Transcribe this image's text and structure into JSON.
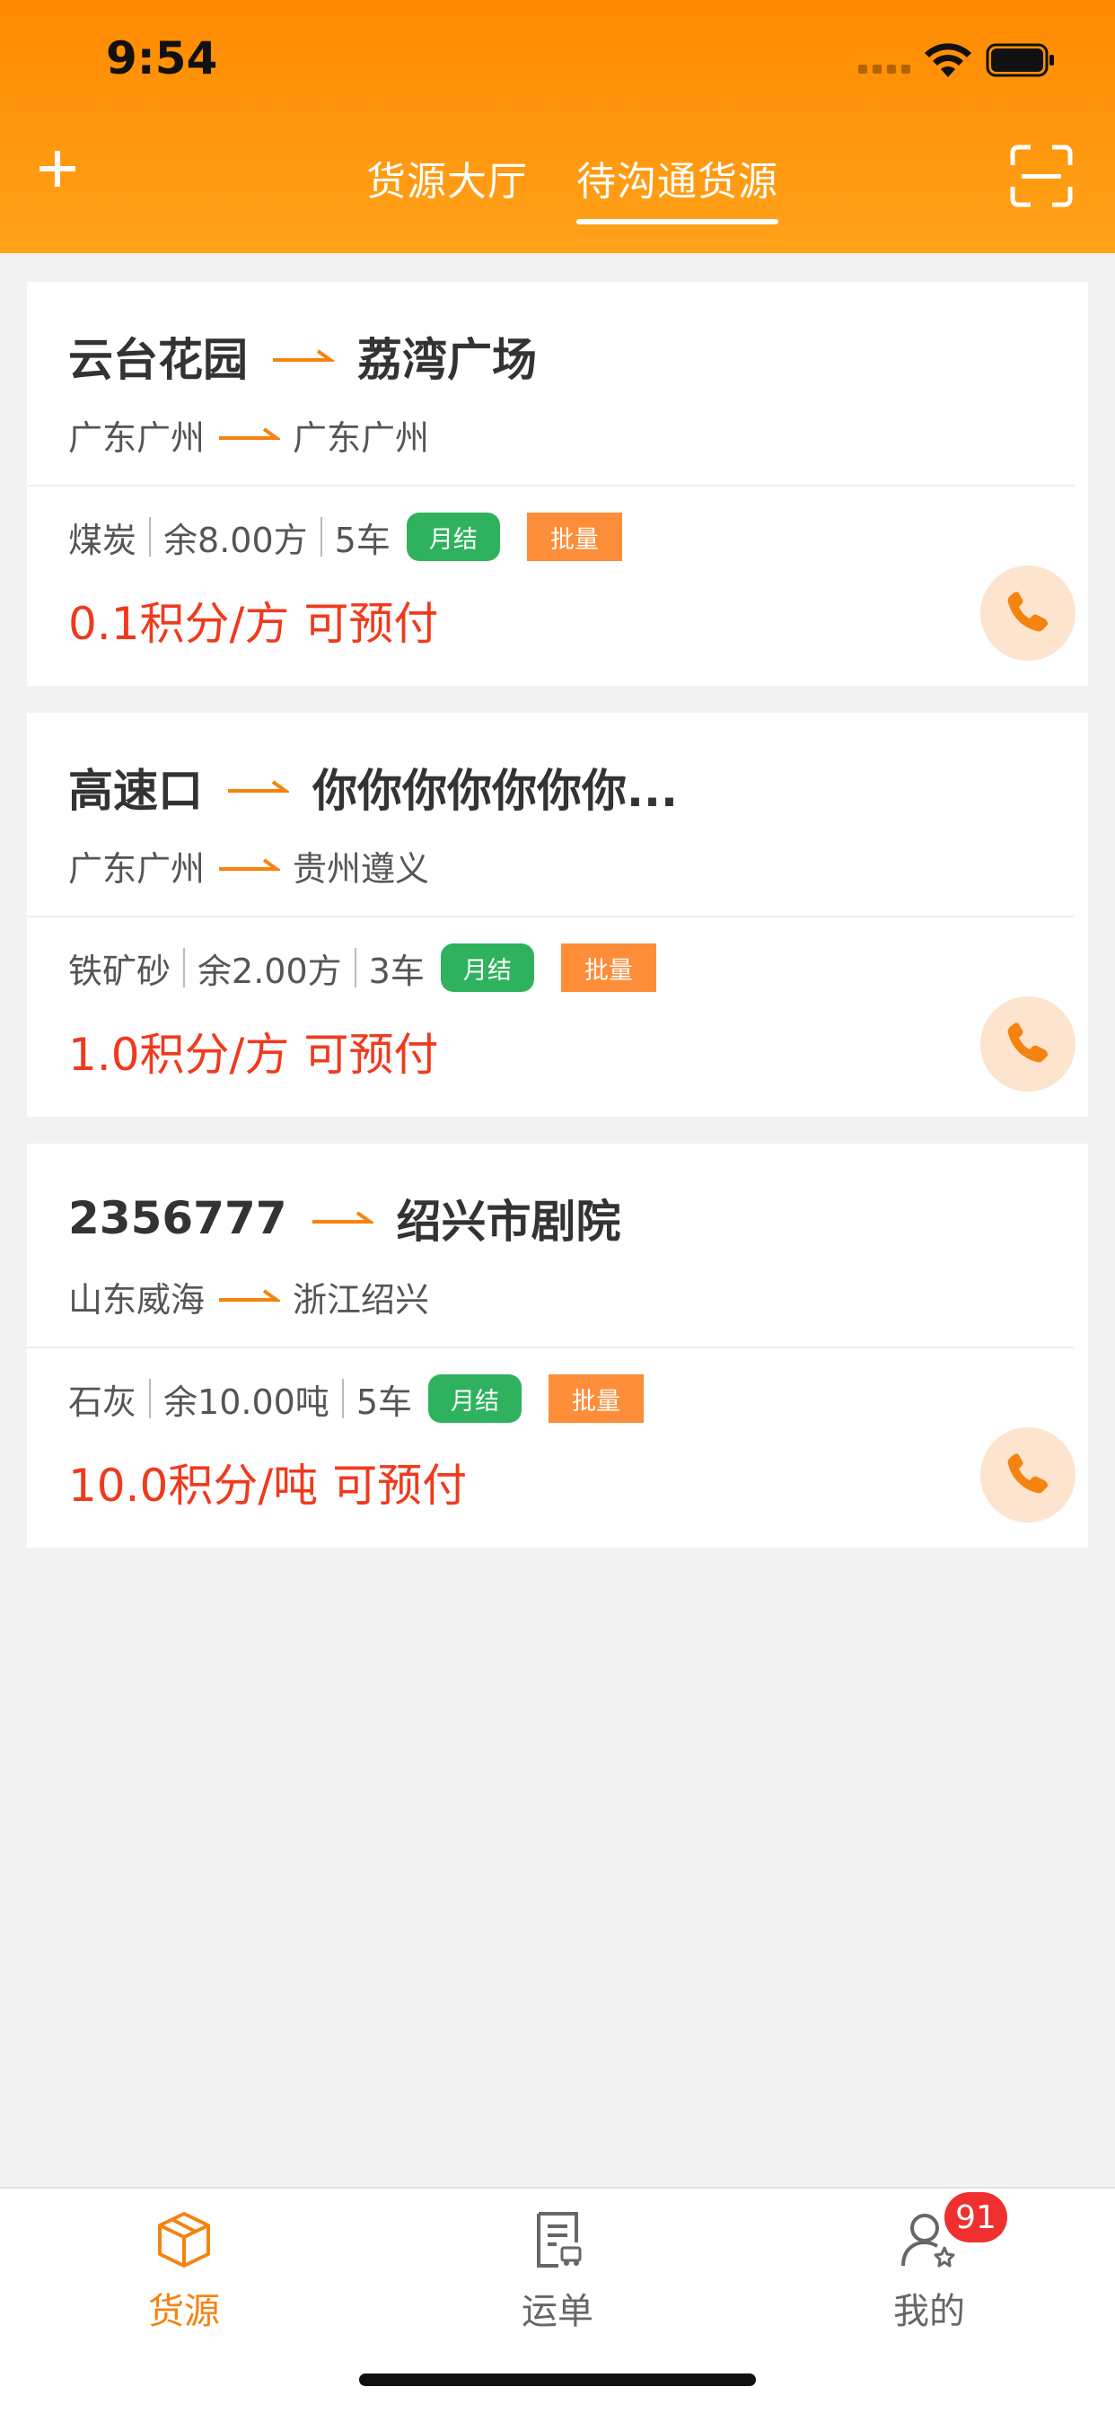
{
  "status_bar": {
    "time": "9:54"
  },
  "header": {
    "tabs": [
      {
        "label": "货源大厅",
        "active": false
      },
      {
        "label": "待沟通货源",
        "active": true
      }
    ],
    "accent": "#ff8a00"
  },
  "cards": [
    {
      "from": "云台花园",
      "to": "荔湾广场",
      "from_region": "广东广州",
      "to_region": "广东广州",
      "cargo": "煤炭",
      "remaining": "余8.00方",
      "trucks": "5车",
      "badge_settle": "月结",
      "badge_batch": "批量",
      "price": "0.1积分/方",
      "prepay": "可预付"
    },
    {
      "from": "高速口",
      "to": "你你你你你你你...",
      "from_region": "广东广州",
      "to_region": "贵州遵义",
      "cargo": "铁矿砂",
      "remaining": "余2.00方",
      "trucks": "3车",
      "badge_settle": "月结",
      "badge_batch": "批量",
      "price": "1.0积分/方",
      "prepay": "可预付"
    },
    {
      "from": "2356777",
      "to": "绍兴市剧院",
      "from_region": "山东威海",
      "to_region": "浙江绍兴",
      "cargo": "石灰",
      "remaining": "余10.00吨",
      "trucks": "5车",
      "badge_settle": "月结",
      "badge_batch": "批量",
      "price": "10.0积分/吨",
      "prepay": "可预付"
    }
  ],
  "tabbar": {
    "items": [
      {
        "label": "货源",
        "icon": "box-icon",
        "active": true
      },
      {
        "label": "运单",
        "icon": "waybill-icon",
        "active": false
      },
      {
        "label": "我的",
        "icon": "user-icon",
        "active": false
      }
    ],
    "badge": "91"
  },
  "colors": {
    "price": "#f03a1d",
    "badge_green": "#2fb25e",
    "badge_orange": "#fe8d39",
    "tab_active": "#f5830f"
  }
}
